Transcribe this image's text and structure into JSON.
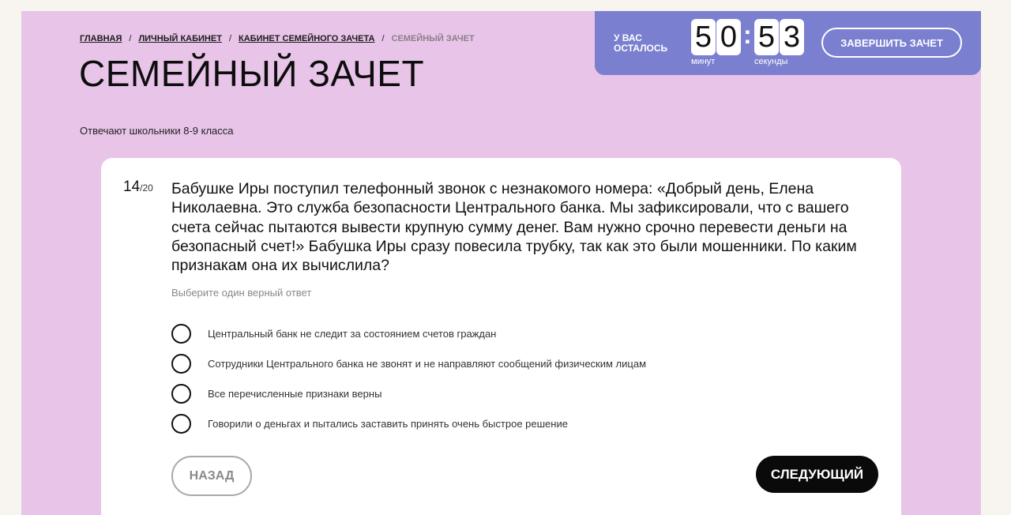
{
  "breadcrumb": {
    "items": [
      "ГЛАВНАЯ",
      "ЛИЧНЫЙ КАБИНЕТ",
      "КАБИНЕТ СЕМЕЙНОГО ЗАЧЕТА"
    ],
    "separator": "/",
    "current": "СЕМЕЙНЫЙ ЗАЧЕТ"
  },
  "page": {
    "title": "СЕМЕЙНЫЙ ЗАЧЕТ",
    "audience": "Отвечают школьники 8-9 класса"
  },
  "timer": {
    "caption": "У ВАС ОСТАЛОСЬ",
    "minutes_digits": [
      "5",
      "0"
    ],
    "seconds_digits": [
      "5",
      "3"
    ],
    "separator": ":",
    "minutes_label": "минут",
    "seconds_label": "секунды",
    "finish_label": "ЗАВЕРШИТЬ ЗАЧЕТ"
  },
  "question": {
    "number": "14",
    "total": "/20",
    "text": "Бабушке Иры поступил телефонный звонок с незнакомого номера: «Добрый день, Елена Николаевна. Это служба безопасности Центрального банка. Мы зафиксировали, что с вашего счета сейчас пытаются вывести крупную сумму денег. Вам нужно срочно перевести деньги на безопасный счет!» Бабушка Иры сразу повесила трубку, так как это были мошенники. По каким признакам она их вычислила?",
    "hint": "Выберите один верный ответ",
    "options": [
      "Центральный банк не следит за состоянием счетов граждан",
      "Сотрудники Центрального банка не звонят и не направляют сообщений физическим лицам",
      "Все перечисленные признаки верны",
      "Говорили о деньгах и пытались заставить принять очень быстрое решение"
    ]
  },
  "nav": {
    "back_label": "НАЗАД",
    "next_label": "СЛЕДУЮЩИЙ"
  },
  "colors": {
    "page_bg": "#e8c4e8",
    "timer_bg": "#7a7fcf",
    "card_bg": "#ffffff",
    "next_btn_bg": "#0a0a0a"
  }
}
